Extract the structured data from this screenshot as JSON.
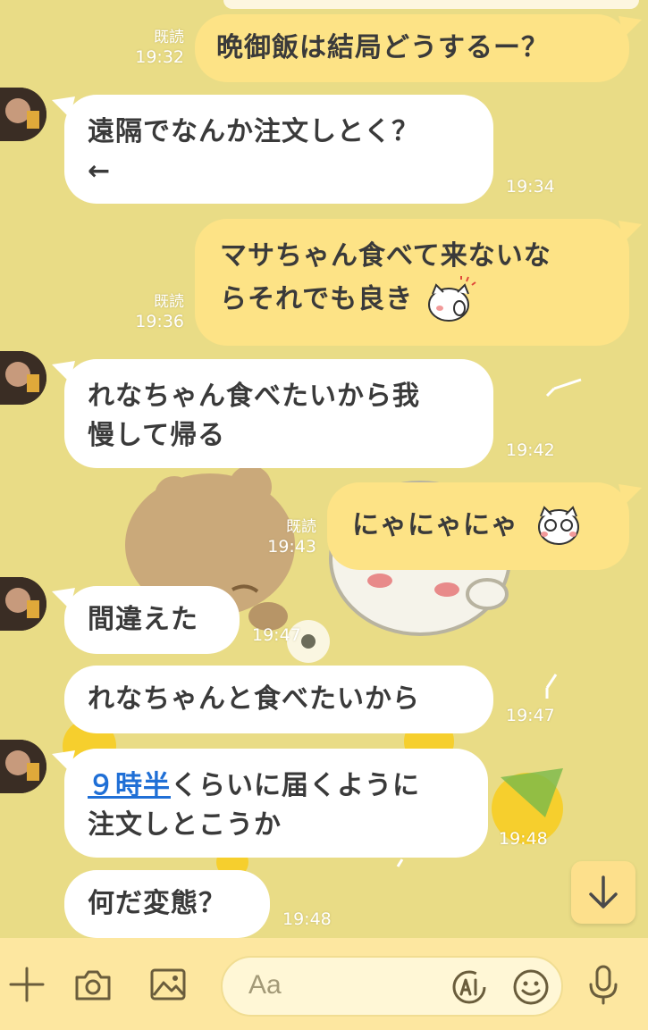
{
  "colors": {
    "chat_background": "#e9dc86",
    "incoming_bubble": "#ffffff",
    "outgoing_bubble": "#fde386",
    "link": "#1f6fd6",
    "input_bar": "#fde7a0"
  },
  "messages": [
    {
      "direction": "out",
      "text": "晩御飯は結局どうするー？",
      "read": "既読",
      "time": "19:32"
    },
    {
      "direction": "in",
      "text_line1": "遠隔でなんか注文しとく？",
      "text_line2": "←",
      "time": "19:34"
    },
    {
      "direction": "out",
      "text_line1": "マサちゃん食べて来ないな",
      "text_line2": "らそれでも良き",
      "sticker_icon": "cat-shy-emoji-icon",
      "read": "既読",
      "time": "19:36"
    },
    {
      "direction": "in",
      "text_line1": "れなちゃん食べたいから我",
      "text_line2": "慢して帰る",
      "time": "19:42"
    },
    {
      "direction": "out",
      "text": "にゃにゃにゃ",
      "sticker_icon": "cat-glasses-emoji-icon",
      "read": "既読",
      "time": "19:43"
    },
    {
      "direction": "in",
      "text": "間違えた",
      "time": "19:47"
    },
    {
      "direction": "in",
      "text": "れなちゃんと食べたいから",
      "time": "19:47"
    },
    {
      "direction": "in",
      "link": "９時半",
      "text_line1_rest": "くらいに届くように",
      "text_line2": "注文しとこうか",
      "time": "19:48"
    },
    {
      "direction": "in",
      "text": "何だ変態？",
      "time": "19:48"
    }
  ],
  "input": {
    "placeholder": "Aa"
  },
  "icons": {
    "add": "plus-icon",
    "camera": "camera-icon",
    "gallery": "image-icon",
    "ai": "ai-icon",
    "emoji": "smiley-icon",
    "mic": "microphone-icon",
    "scroll_down": "arrow-down-icon"
  }
}
